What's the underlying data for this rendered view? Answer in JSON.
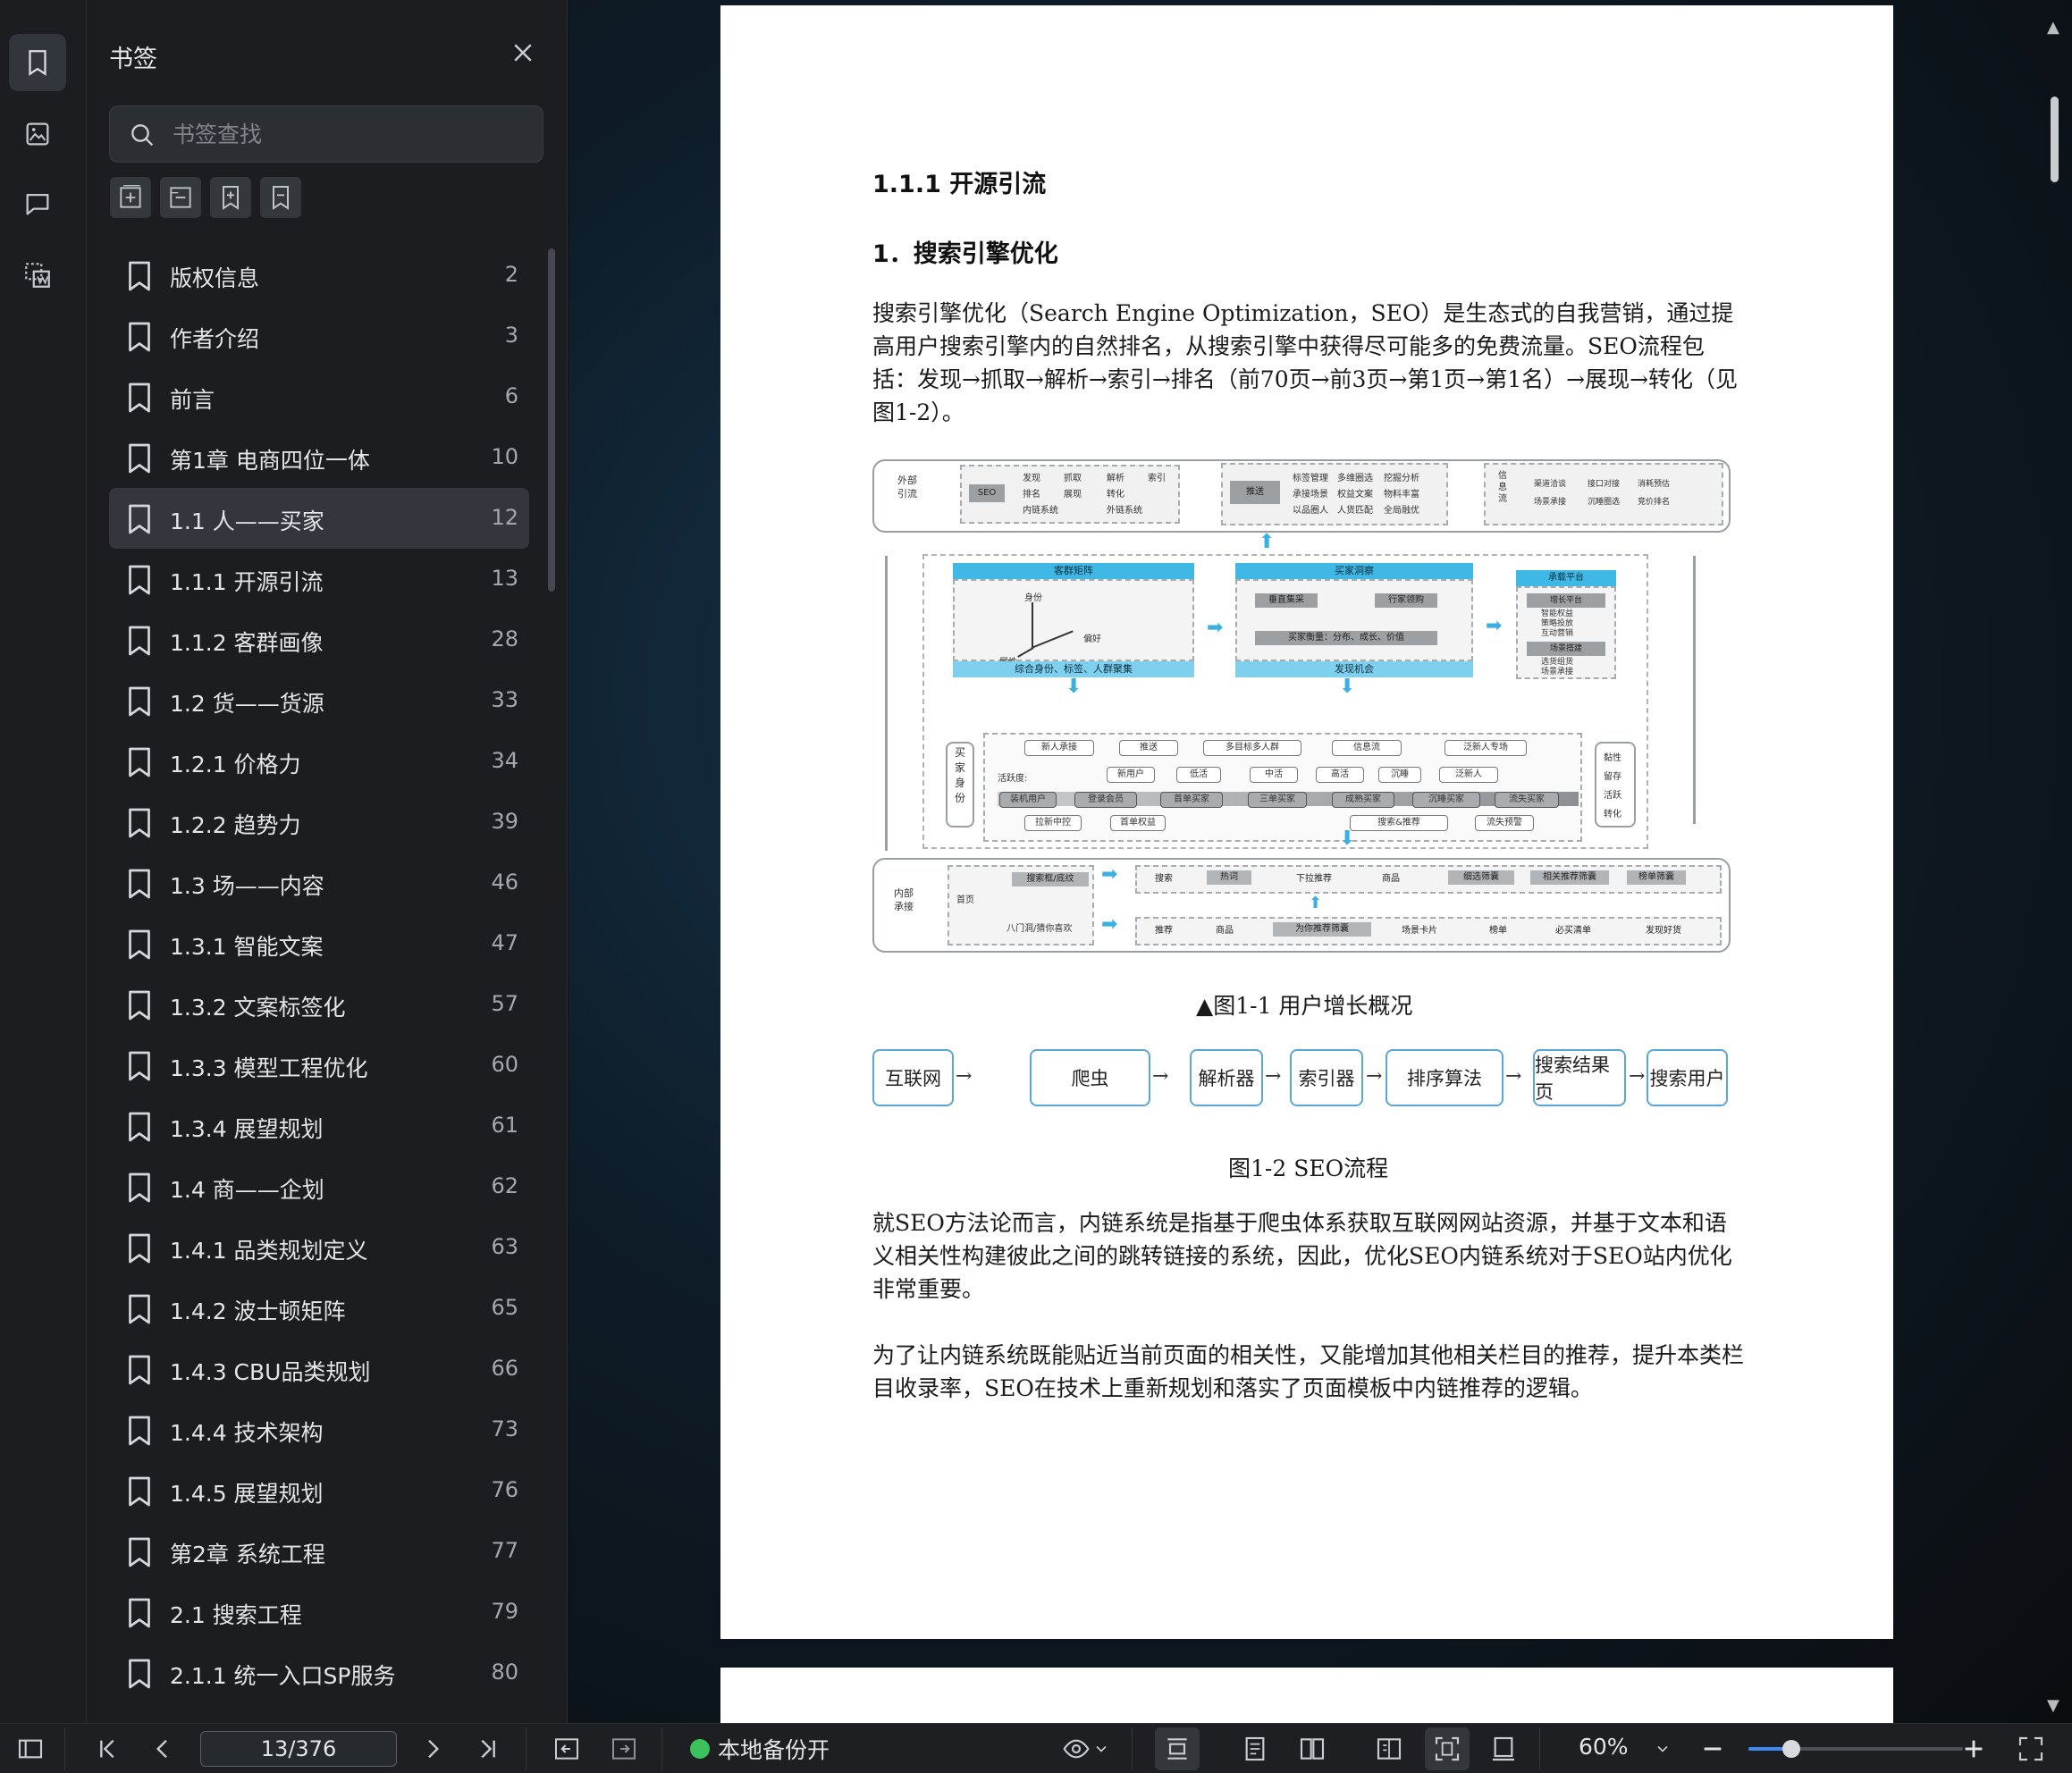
{
  "rail": {
    "items": [
      {
        "name": "bookmark-icon",
        "active": true
      },
      {
        "name": "thumbnail-icon",
        "active": false
      },
      {
        "name": "comment-icon",
        "active": false
      },
      {
        "name": "extract-icon",
        "active": false
      }
    ]
  },
  "panel": {
    "title": "书签",
    "search_placeholder": "书签查找",
    "tools": [
      "expand-all-icon",
      "collapse-all-icon",
      "add-bookmark-icon",
      "remove-bookmark-icon"
    ],
    "items": [
      {
        "label": "版权信息",
        "page": "2"
      },
      {
        "label": "作者介绍",
        "page": "3"
      },
      {
        "label": "前言",
        "page": "6"
      },
      {
        "label": "第1章 电商四位一体",
        "page": "10"
      },
      {
        "label": "1.1 人——买家",
        "page": "12",
        "selected": true
      },
      {
        "label": "1.1.1 开源引流",
        "page": "13"
      },
      {
        "label": "1.1.2 客群画像",
        "page": "28"
      },
      {
        "label": "1.2 货——货源",
        "page": "33"
      },
      {
        "label": "1.2.1 价格力",
        "page": "34"
      },
      {
        "label": "1.2.2 趋势力",
        "page": "39"
      },
      {
        "label": "1.3 场——内容",
        "page": "46"
      },
      {
        "label": "1.3.1 智能文案",
        "page": "47"
      },
      {
        "label": "1.3.2 文案标签化",
        "page": "57"
      },
      {
        "label": "1.3.3 模型工程优化",
        "page": "60"
      },
      {
        "label": "1.3.4 展望规划",
        "page": "61"
      },
      {
        "label": "1.4 商——企划",
        "page": "62"
      },
      {
        "label": "1.4.1 品类规划定义",
        "page": "63"
      },
      {
        "label": "1.4.2 波士顿矩阵",
        "page": "65"
      },
      {
        "label": "1.4.3 CBU品类规划",
        "page": "66"
      },
      {
        "label": "1.4.4 技术架构",
        "page": "73"
      },
      {
        "label": "1.4.5 展望规划",
        "page": "76"
      },
      {
        "label": "第2章 系统工程",
        "page": "77"
      },
      {
        "label": "2.1 搜索工程",
        "page": "79"
      },
      {
        "label": "2.1.1 统一入口SP服务",
        "page": "80"
      }
    ]
  },
  "doc": {
    "section": "1.1.1 开源引流",
    "subsection": "1．搜索引擎优化",
    "para1": "搜索引擎优化（Search Engine Optimization，SEO）是生态式的自我营销，通过提高用户搜索引擎内的自然排名，从搜索引擎中获得尽可能多的免费流量。SEO流程包括：发现→抓取→解析→索引→排名（前70页→前3页→第1页→第1名）→展现→转化（见图1-2）。",
    "fig1": {
      "caption": "▲图1-1 用户增长概况",
      "top_left_label": "外部\n引流",
      "seo": "SEO",
      "seo_items": [
        "发现",
        "抓取",
        "解析",
        "索引",
        "排名",
        "展现",
        "转化",
        "内链系统",
        "外链系统"
      ],
      "push": "推送",
      "push_items": [
        "标签管理",
        "多维圈选",
        "挖掘分析",
        "承接场景",
        "权益文案",
        "物料丰富",
        "以品圈人",
        "人货匹配",
        "全局融优"
      ],
      "info": "信\n息\n流",
      "info_items": [
        "渠道洽谈",
        "接口对接",
        "消耗预估",
        "场景承接",
        "沉睡圈选",
        "竞价排名"
      ],
      "p1_title": "客群矩阵",
      "p1_axes": [
        "身份",
        "偏好",
        "属性"
      ],
      "p1_footer": "综合身份、标签、人群聚集",
      "p2_title": "买家洞察",
      "p2_items": [
        "垂直集采",
        "行家领购",
        "买家衡量：分布、成长、价值"
      ],
      "p2_footer": "发现机会",
      "p3_title": "承载平台",
      "p3_a": "增长平台",
      "p3_a_items": "智能权益\n策略投放\n互动营销",
      "p3_b": "场景搭建",
      "p3_b_items": "选货组货\n场景承接",
      "buyer": "买\n家\n身\n份",
      "row1": [
        "新人承接",
        "推送",
        "多目标多人群",
        "信息流",
        "泛新人专场"
      ],
      "activity": "活跃度:",
      "row2": [
        "新用户",
        "低活",
        "中活",
        "高活",
        "沉睡",
        "泛新人"
      ],
      "row3": [
        "装机用户",
        "登录会员",
        "首单买家",
        "三单买家",
        "成熟买家",
        "沉睡买家",
        "流失买家"
      ],
      "row4": [
        "拉新中控",
        "首单权益",
        "搜索&推荐",
        "流失预警"
      ],
      "right_tags": "黏性\n留存\n活跃\n转化",
      "bottom_label": "内部\n承接",
      "home": "首页",
      "search_box": "搜索框/底纹",
      "eight": "八门洞/猜你喜欢",
      "bottom_row1": [
        "搜索",
        "热词",
        "下拉推荐",
        "商品",
        "细选筛囊",
        "相关推荐筛囊",
        "榜单筛囊"
      ],
      "bottom_row2": [
        "推荐",
        "商品",
        "为你推荐筛囊",
        "场景卡片",
        "榜单",
        "必买清单",
        "发现好货"
      ]
    },
    "fig2": {
      "caption": "图1-2 SEO流程",
      "steps": [
        "互联网",
        "爬虫",
        "解析器",
        "索引器",
        "排序算法",
        "搜索结果页",
        "搜索用户"
      ]
    },
    "para2": "就SEO方法论而言，内链系统是指基于爬虫体系获取互联网网站资源，并基于文本和语义相关性构建彼此之间的跳转链接的系统，因此，优化SEO内链系统对于SEO站内优化非常重要。",
    "para3": "为了让内链系统既能贴近当前页面的相关性，又能增加其他相关栏目的推荐，提升本类栏目收录率，SEO在技术上重新规划和落实了页面模板中内链推荐的逻辑。"
  },
  "status": {
    "page_indicator": "13/376",
    "backup": "本地备份开",
    "zoom": "60%",
    "zoom_fraction": 0.2
  }
}
